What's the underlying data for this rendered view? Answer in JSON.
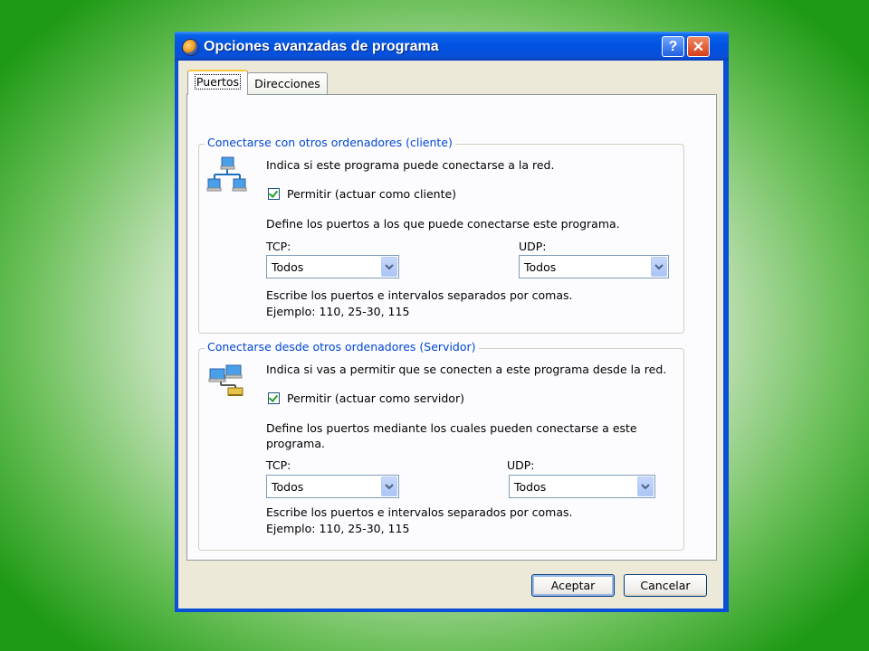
{
  "window": {
    "title": "Opciones avanzadas de programa",
    "help_label": "?",
    "close_label": "✕"
  },
  "tabs": [
    {
      "label": "Puertos",
      "active": true
    },
    {
      "label": "Direcciones",
      "active": false
    }
  ],
  "client_group": {
    "legend": "Conectarse con otros ordenadores (cliente)",
    "intro": "Indica si este programa puede conectarse a la red.",
    "checkbox_label": "Permitir (actuar como cliente)",
    "checked": true,
    "ports_desc": "Define los puertos a los que puede conectarse este programa.",
    "tcp_label": "TCP:",
    "tcp_value": "Todos",
    "udp_label": "UDP:",
    "udp_value": "Todos",
    "hint_line1": "Escribe los puertos e intervalos separados por comas.",
    "hint_line2": "Ejemplo: 110, 25-30, 115"
  },
  "server_group": {
    "legend": "Conectarse desde otros ordenadores (Servidor)",
    "intro": "Indica si vas a permitir que se conecten a este programa desde la red.",
    "checkbox_label": "Permitir (actuar como servidor)",
    "checked": true,
    "ports_desc_line1": "Define los puertos mediante los cuales pueden conectarse a este",
    "ports_desc_line2": "programa.",
    "tcp_label": "TCP:",
    "tcp_value": "Todos",
    "udp_label": "UDP:",
    "udp_value": "Todos",
    "hint_line1": "Escribe los puertos e intervalos separados por comas.",
    "hint_line2": "Ejemplo: 110, 25-30, 115"
  },
  "buttons": {
    "accept": "Aceptar",
    "cancel": "Cancelar"
  },
  "colors": {
    "titlebar": "#0a4fd8",
    "legend_text": "#0046d5",
    "dialog_face": "#ece9d8",
    "close_button": "#d2401b",
    "background_green": "#1f9a16"
  },
  "icons": [
    "app-icon",
    "help-icon",
    "close-icon",
    "network-client-icon",
    "network-server-icon",
    "chevron-down-icon",
    "checkmark-icon"
  ]
}
